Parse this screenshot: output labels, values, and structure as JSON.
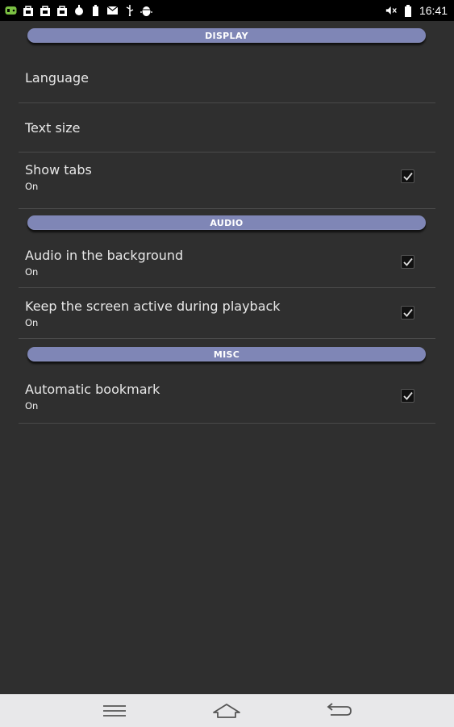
{
  "statusbar": {
    "time": "16:41",
    "left_icons": [
      "game-controller-icon",
      "store-bag-icon",
      "store-bag-icon",
      "store-bag-icon",
      "bulb-icon",
      "battery-small-icon",
      "mail-icon",
      "usb-icon",
      "android-debug-icon"
    ],
    "right_icons": [
      "mute-volume-icon",
      "battery-icon"
    ]
  },
  "sections": {
    "display": {
      "header": "DISPLAY",
      "language": {
        "title": "Language"
      },
      "text_size": {
        "title": "Text size"
      },
      "show_tabs": {
        "title": "Show tabs",
        "summary": "On",
        "checked": true
      }
    },
    "audio": {
      "header": "AUDIO",
      "background": {
        "title": "Audio in the background",
        "summary": "On",
        "checked": true
      },
      "screen_active": {
        "title": "Keep the screen active during playback",
        "summary": "On",
        "checked": true
      }
    },
    "misc": {
      "header": "MISC",
      "bookmark": {
        "title": "Automatic bookmark",
        "summary": "On",
        "checked": true
      }
    }
  },
  "navbar": {
    "buttons": [
      "menu-icon",
      "home-icon",
      "back-icon"
    ]
  },
  "colors": {
    "background": "#2f2f2f",
    "section_pill": "#7f86b6",
    "navbar": "#e8e8ea"
  }
}
